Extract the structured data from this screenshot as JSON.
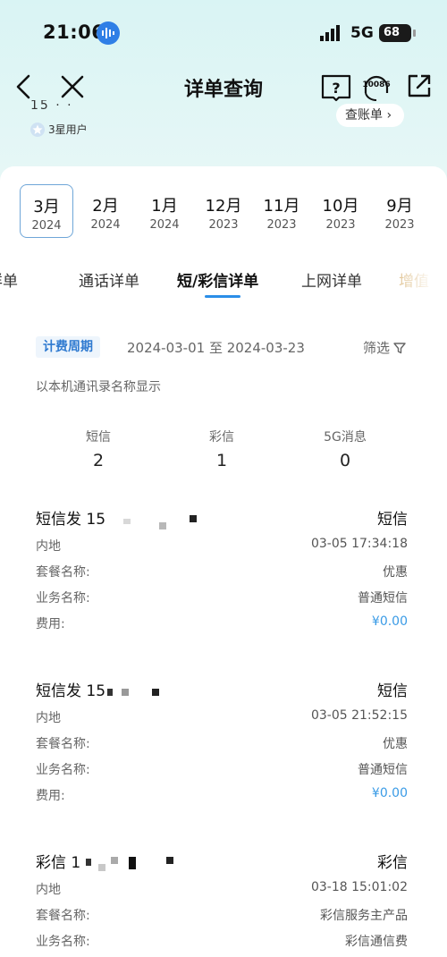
{
  "status_bar": {
    "time": "21:06",
    "network": "5G",
    "battery": "68"
  },
  "nav": {
    "title": "详单查询",
    "hotline": "10086"
  },
  "user": {
    "number_partial": "15  ·  ·",
    "level": "3星用户",
    "bill_link": "查账单 ›"
  },
  "months": [
    {
      "month": "3月",
      "year": "2024",
      "active": true
    },
    {
      "month": "2月",
      "year": "2024"
    },
    {
      "month": "1月",
      "year": "2024"
    },
    {
      "month": "12月",
      "year": "2023"
    },
    {
      "month": "11月",
      "year": "2023"
    },
    {
      "month": "10月",
      "year": "2023"
    },
    {
      "month": "9月",
      "year": "2023"
    }
  ],
  "tabs": [
    "详单",
    "通话详单",
    "短/彩信详单",
    "上网详单",
    "增值"
  ],
  "period": {
    "tag": "计费周期",
    "range": "2024-03-01  至  2024-03-23",
    "filter": "筛选"
  },
  "note": "以本机通讯录名称显示",
  "counts": [
    {
      "label": "短信",
      "value": "2"
    },
    {
      "label": "彩信",
      "value": "1"
    },
    {
      "label": "5G消息",
      "value": "0"
    }
  ],
  "records": [
    {
      "title": "短信发 15",
      "type": "短信",
      "region": "内地",
      "time": "03-05 17:34:18",
      "package_label": "套餐名称:",
      "package": "优惠",
      "service_label": "业务名称:",
      "service": "普通短信",
      "fee_label": "费用:",
      "fee": "¥0.00"
    },
    {
      "title": "短信发 15",
      "type": "短信",
      "region": "内地",
      "time": "03-05 21:52:15",
      "package_label": "套餐名称:",
      "package": "优惠",
      "service_label": "业务名称:",
      "service": "普通短信",
      "fee_label": "费用:",
      "fee": "¥0.00"
    },
    {
      "title": "彩信 1",
      "type": "彩信",
      "region": "内地",
      "time": "03-18 15:01:02",
      "package_label": "套餐名称:",
      "package": "彩信服务主产品",
      "service_label": "业务名称:",
      "service": "彩信通信费"
    }
  ]
}
